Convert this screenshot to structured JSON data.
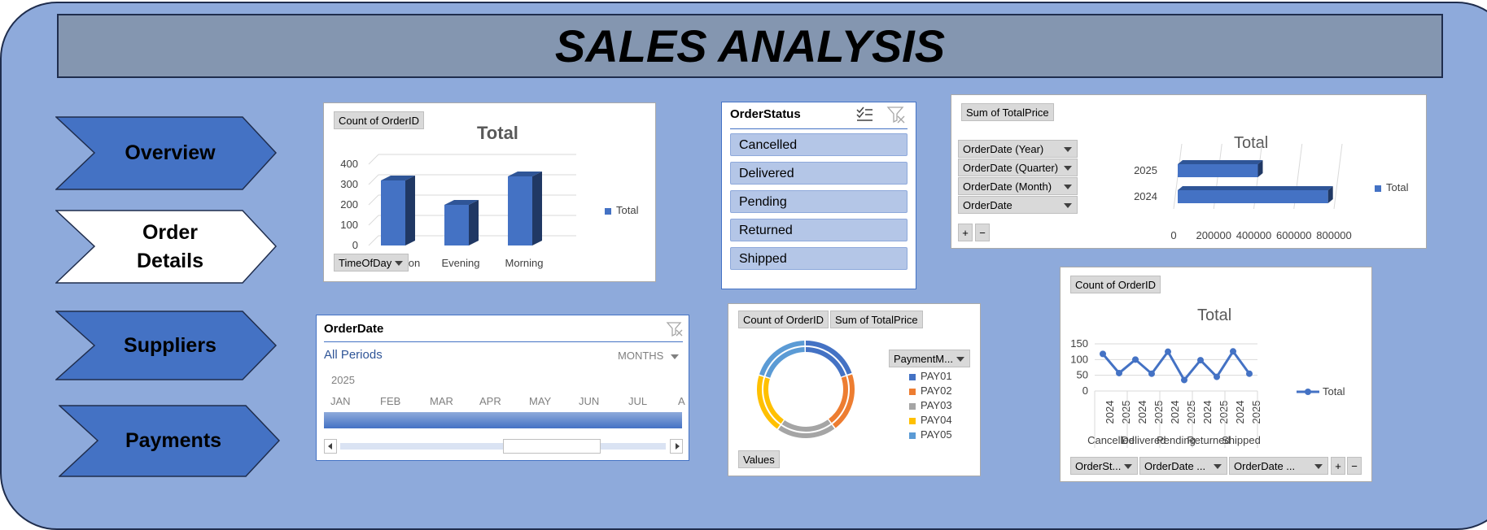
{
  "title": "SALES ANALYSIS",
  "nav": [
    {
      "label_line1": "Overview",
      "label_line2": "",
      "fill": "#4472c4"
    },
    {
      "label_line1": "Order",
      "label_line2": "Details",
      "fill": "#ffffff"
    },
    {
      "label_line1": "Suppliers",
      "label_line2": "",
      "fill": "#4472c4"
    },
    {
      "label_line1": "Payments",
      "label_line2": "",
      "fill": "#4472c4"
    }
  ],
  "bar_chart": {
    "field_value": "Count of OrderID",
    "title": "Total",
    "legend": "Total",
    "axis_field": "TimeOfDay",
    "y_ticks": [
      "400",
      "300",
      "200",
      "100",
      "0"
    ],
    "categories": [
      "Afternoon",
      "Evening",
      "Morning"
    ],
    "values": [
      320,
      200,
      340
    ],
    "ylim": [
      0,
      400
    ],
    "color": "#4472c4"
  },
  "status_slicer": {
    "title": "OrderStatus",
    "items": [
      "Cancelled",
      "Delivered",
      "Pending",
      "Returned",
      "Shipped"
    ]
  },
  "hbar_chart": {
    "field_value": "Sum of TotalPrice",
    "title": "Total",
    "legend": "Total",
    "filters": [
      "OrderDate (Year)",
      "OrderDate (Quarter)",
      "OrderDate (Month)",
      "OrderDate"
    ],
    "categories": [
      "2025",
      "2024"
    ],
    "values": [
      400000,
      750000
    ],
    "x_ticks": [
      "0",
      "200000",
      "400000",
      "600000",
      "800000"
    ],
    "xlim": [
      0,
      800000
    ],
    "plus": "+",
    "minus": "−"
  },
  "timeline": {
    "title": "OrderDate",
    "all_periods": "All Periods",
    "level": "MONTHS",
    "year": "2025",
    "months": [
      "JAN",
      "FEB",
      "MAR",
      "APR",
      "MAY",
      "JUN",
      "JUL",
      "A"
    ]
  },
  "donut_chart": {
    "field_value1": "Count of OrderID",
    "field_value2": "Sum of TotalPrice",
    "legend_field": "PaymentM...",
    "values_btn": "Values",
    "legend": [
      "PAY01",
      "PAY02",
      "PAY03",
      "PAY04",
      "PAY05"
    ],
    "colors": [
      "#4472c4",
      "#ed7d31",
      "#a5a5a5",
      "#ffc000",
      "#5b9bd5"
    ],
    "values": [
      20,
      20,
      20,
      20,
      20
    ]
  },
  "line_chart": {
    "field_value": "Count of OrderID",
    "title": "Total",
    "legend": "Total",
    "y_ticks": [
      "150",
      "100",
      "50",
      "0"
    ],
    "ylim": [
      0,
      150
    ],
    "years": [
      "2024",
      "2025",
      "2024",
      "2025",
      "2024",
      "2025",
      "2024",
      "2025",
      "2024",
      "2025"
    ],
    "groups": [
      "Cancelled",
      "Delivered",
      "Pending",
      "Returned",
      "Shipped"
    ],
    "values": [
      118,
      57,
      100,
      55,
      125,
      35,
      98,
      45,
      126,
      55
    ],
    "filters": [
      "OrderSt...",
      "OrderDate ...",
      "OrderDate ..."
    ],
    "plus": "+",
    "minus": "−"
  }
}
